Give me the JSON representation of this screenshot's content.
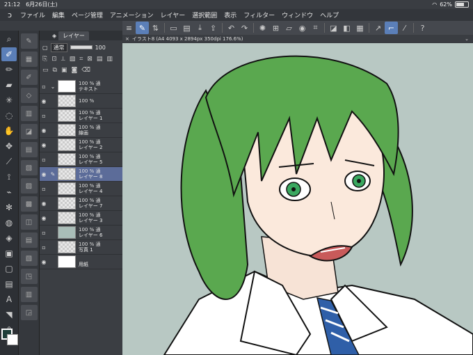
{
  "status_bar": {
    "time": "21:12",
    "date": "6月26日(土)",
    "battery": "62%"
  },
  "menu": {
    "items": [
      "ファイル",
      "編集",
      "ページ管理",
      "アニメーション",
      "レイヤー",
      "選択範囲",
      "表示",
      "フィルター",
      "ウィンドウ",
      "ヘルプ"
    ]
  },
  "canvas_tab": {
    "title": "イラスト8 (A4 4093 x 2894px 350dpi 176.6%)"
  },
  "layer_panel": {
    "tab": "レイヤー",
    "blend_mode": "通常",
    "opacity": "100",
    "layers": [
      {
        "pct": "100 % 通",
        "name": "テキスト",
        "visible": false,
        "thumb": "folder"
      },
      {
        "pct": "100 %",
        "name": "",
        "visible": true,
        "thumb": "text"
      },
      {
        "pct": "100 % 通",
        "name": "レイヤー 1",
        "visible": false,
        "thumb": "checker"
      },
      {
        "pct": "100 % 通",
        "name": "線画",
        "visible": true,
        "thumb": "checker"
      },
      {
        "pct": "100 % 通",
        "name": "レイヤー 2",
        "visible": true,
        "thumb": "checker"
      },
      {
        "pct": "100 % 通",
        "name": "レイヤー 5",
        "visible": false,
        "thumb": "checker"
      },
      {
        "pct": "100 % 通",
        "name": "レイヤー 8",
        "visible": true,
        "thumb": "checker",
        "selected": true
      },
      {
        "pct": "100 % 通",
        "name": "レイヤー 4",
        "visible": false,
        "thumb": "checker"
      },
      {
        "pct": "100 % 通",
        "name": "レイヤー 7",
        "visible": true,
        "thumb": "checker"
      },
      {
        "pct": "100 % 通",
        "name": "レイヤー 3",
        "visible": true,
        "thumb": "checker"
      },
      {
        "pct": "100 % 通",
        "name": "レイヤー 6",
        "visible": false,
        "thumb": "teal"
      },
      {
        "pct": "100 % 通",
        "name": "写真 1",
        "visible": false,
        "thumb": "checker"
      },
      {
        "pct": "",
        "name": "用紙",
        "visible": true,
        "thumb": "white"
      }
    ]
  },
  "colors": {
    "main": "#1f3f3a",
    "sub": "#ffffff",
    "canvas_bg": "#b8c8c3",
    "hair": "#5aa84f",
    "skin": "#fbe9dc"
  }
}
